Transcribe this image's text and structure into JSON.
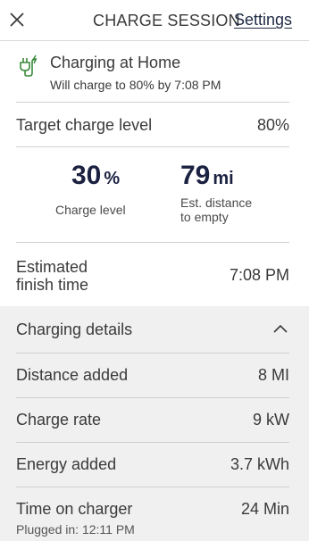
{
  "header": {
    "title": "CHARGE SESSION",
    "settings_label": "Settings"
  },
  "status": {
    "title": "Charging at Home",
    "subtitle": "Will charge to 80% by 7:08 PM",
    "icon": "charging-plug-icon",
    "icon_color": "#3a8a3a"
  },
  "target": {
    "label": "Target charge level",
    "value": "80%"
  },
  "stats": {
    "charge_level": {
      "value": "30",
      "unit": "%",
      "label": "Charge level"
    },
    "distance": {
      "value": "79",
      "unit": "mi",
      "label_line1": "Est. distance",
      "label_line2": "to empty"
    }
  },
  "finish": {
    "label_line1": "Estimated",
    "label_line2": "finish time",
    "value": "7:08 PM"
  },
  "details": {
    "title": "Charging details",
    "rows": [
      {
        "label": "Distance added",
        "value": "8 MI"
      },
      {
        "label": "Charge rate",
        "value": "9 kW"
      },
      {
        "label": "Energy added",
        "value": "3.7 kWh"
      },
      {
        "label": "Time on charger",
        "value": "24 Min",
        "sub": "Plugged in: 12:11 PM"
      }
    ]
  }
}
